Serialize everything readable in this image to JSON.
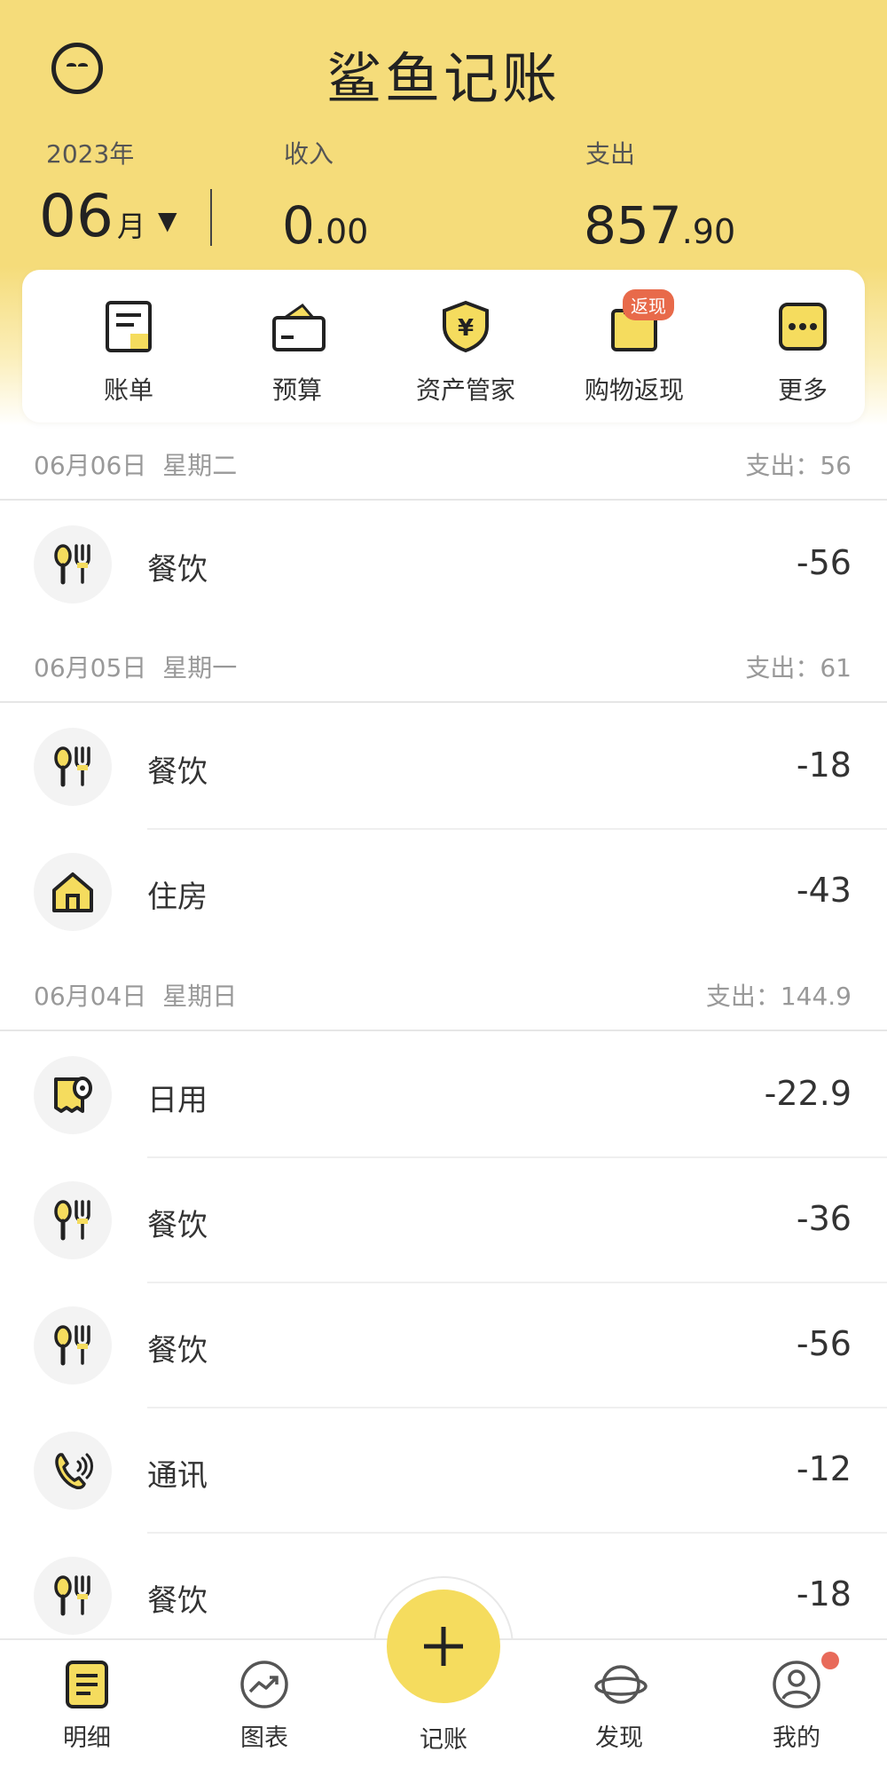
{
  "header": {
    "app_title": "鲨鱼记账",
    "year": "2023年",
    "month": "06",
    "month_unit": "月",
    "month_caret": "▼",
    "income_label": "收入",
    "income_int": "0",
    "income_dec": ".00",
    "expense_label": "支出",
    "expense_int": "857",
    "expense_dec": ".90"
  },
  "shortcuts": [
    {
      "label": "账单",
      "icon": "bill-icon"
    },
    {
      "label": "预算",
      "icon": "wallet-icon"
    },
    {
      "label": "资产管家",
      "icon": "shield-yen-icon"
    },
    {
      "label": "购物返现",
      "icon": "shopping-bag-icon",
      "badge": "返现"
    },
    {
      "label": "更多",
      "icon": "more-icon"
    }
  ],
  "days": [
    {
      "date": "06月06日",
      "weekday": "星期二",
      "total": "支出：56",
      "records": [
        {
          "category": "餐饮",
          "amount": "-56",
          "icon": "dining-icon"
        }
      ]
    },
    {
      "date": "06月05日",
      "weekday": "星期一",
      "total": "支出：61",
      "records": [
        {
          "category": "餐饮",
          "amount": "-18",
          "icon": "dining-icon"
        },
        {
          "category": "住房",
          "amount": "-43",
          "icon": "house-icon"
        }
      ]
    },
    {
      "date": "06月04日",
      "weekday": "星期日",
      "total": "支出：144.9",
      "records": [
        {
          "category": "日用",
          "amount": "-22.9",
          "icon": "tissue-roll-icon"
        },
        {
          "category": "餐饮",
          "amount": "-36",
          "icon": "dining-icon"
        },
        {
          "category": "餐饮",
          "amount": "-56",
          "icon": "dining-icon"
        },
        {
          "category": "通讯",
          "amount": "-12",
          "icon": "phone-icon"
        },
        {
          "category": "餐饮",
          "amount": "-18",
          "icon": "dining-icon"
        }
      ]
    }
  ],
  "tabbar": {
    "detail": "明细",
    "charts": "图表",
    "record": "记账",
    "discover": "发现",
    "mine": "我的"
  },
  "colors": {
    "accent": "#f5dc5e",
    "header_bg": "#f5dc7a",
    "badge": "#e86a4a"
  }
}
